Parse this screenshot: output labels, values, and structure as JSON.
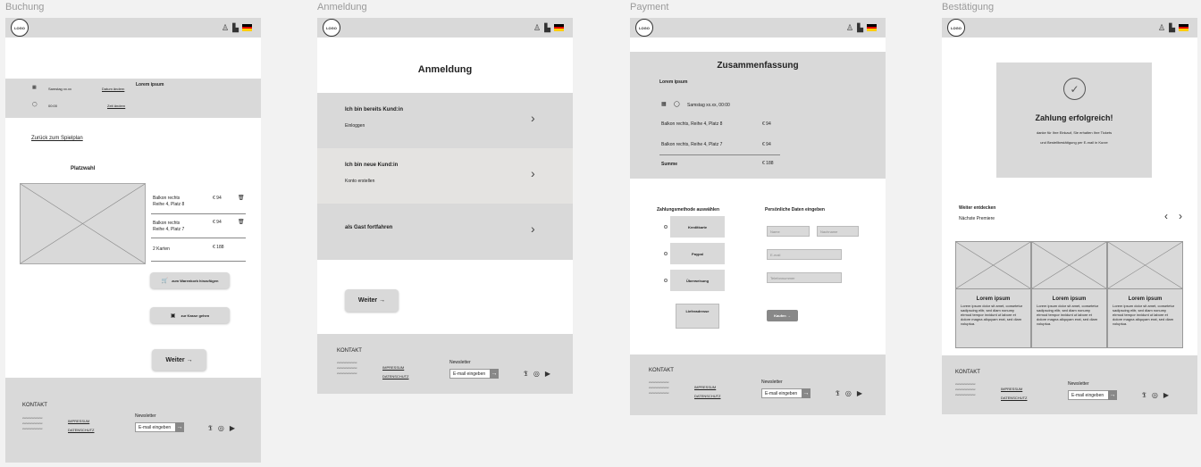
{
  "frames": {
    "buchung": {
      "label": "Buchung"
    },
    "anmeldung": {
      "label": "Anmeldung"
    },
    "payment": {
      "label": "Payment"
    },
    "bestaetigung": {
      "label": "Bestätigung"
    }
  },
  "header": {
    "logo": "LOGO",
    "user_icon": "user-icon",
    "bag_icon": "shopping-bag-icon",
    "flag_colors": [
      "#000000",
      "#dd0000",
      "#ffce00"
    ]
  },
  "buchung": {
    "event_title": "Lorem ipsum",
    "date": "Samstag xx.xx",
    "change_date": "Datum ändern",
    "time": "00:00",
    "change_time": "Zeit ändern",
    "back_link": "Zurück zum Spielplan",
    "seat_title": "Platzwahl",
    "seats": [
      {
        "line1": "Balkon rechts",
        "line2": "Reihe 4, Platz 8",
        "price": "€ 94"
      },
      {
        "line1": "Balkon rechts",
        "line2": "Reihe 4, Platz 7",
        "price": "€ 94"
      }
    ],
    "total_label": "2 Karten",
    "total_price": "€ 188",
    "add_to_cart": "zum Warenkorb hinzufügen",
    "go_to_checkout": "zur Kasse gehen",
    "next": "Weiter →"
  },
  "anmeldung": {
    "title": "Anmeldung",
    "options": [
      {
        "title": "Ich bin bereits Kund:in",
        "sub": "Einloggen"
      },
      {
        "title": "Ich bin neue Kund:in",
        "sub": "Konto erstellen"
      },
      {
        "title": "als Gast fortfahren",
        "sub": ""
      }
    ],
    "next": "Weiter →"
  },
  "payment": {
    "title": "Zusammenfassung",
    "event": "Lorem ipsum",
    "datetime": "Samstag xx.xx, 00:00",
    "items": [
      {
        "label": "Balkon rechts, Reihe 4, Platz 8",
        "price": "€ 94"
      },
      {
        "label": "Balkon rechts, Reihe 4, Platz 7",
        "price": "€ 94"
      }
    ],
    "sum_label": "Summe",
    "sum_price": "€ 188",
    "method_title": "Zahlungsmethode auswählen",
    "methods": [
      "Kreditkarte",
      "Paypal",
      "Überweisung"
    ],
    "delivery": "Lieferadresse",
    "personal_title": "Persönliche Daten eingeben",
    "fields": {
      "first": "Name",
      "last": "Nachname",
      "email": "E-mail",
      "phone": "Telefonnummer"
    },
    "buy": "Kaufen →"
  },
  "bestaetigung": {
    "success_title": "Zahlung erfolgreich!",
    "success_line1": "danke für Ihre Einkauf, Sie erhalten Ihre Tickets",
    "success_line2": "und Bestellbestätigung per E-mail in Kurze",
    "discover_title": "Weiter entdecken",
    "discover_sub": "Nächste Premiere",
    "cards": [
      {
        "title": "Lorem ipsum",
        "text": "Lorem ipsum dolor sit amet, consetetur sadipscing elitr, sed diam nonumy eirmod tempor invidunt ut labore et dolore magna aliquyam erat, sed diam voluptua."
      },
      {
        "title": "Lorem ipsum",
        "text": "Lorem ipsum dolor sit amet, consetetur sadipscing elitr, sed diam nonumy eirmod tempor invidunt ut labore et dolore magna aliquyam erat, sed diam voluptua."
      },
      {
        "title": "Lorem ipsum",
        "text": "Lorem ipsum dolor sit amet, consetetur sadipscing elitr, sed diam nonumy eirmod tempor invidunt ut labore et dolore magna aliquyam erat, sed diam voluptua."
      }
    ]
  },
  "footer": {
    "contact": "KONTAKT",
    "contact_lines": [
      "xxxxxxxxxxxxxxx",
      "xxxxxxxxxxxxxxx",
      "xxxxxxxxxxxxxxx"
    ],
    "impressum": "IMPRESSUM",
    "datenschutz": "DATENSCHUTZ",
    "newsletter": "Newsletter",
    "email_placeholder": "E-mail eingeben",
    "go": "→",
    "social_icons": [
      "twitter-icon",
      "instagram-icon",
      "youtube-icon"
    ]
  }
}
